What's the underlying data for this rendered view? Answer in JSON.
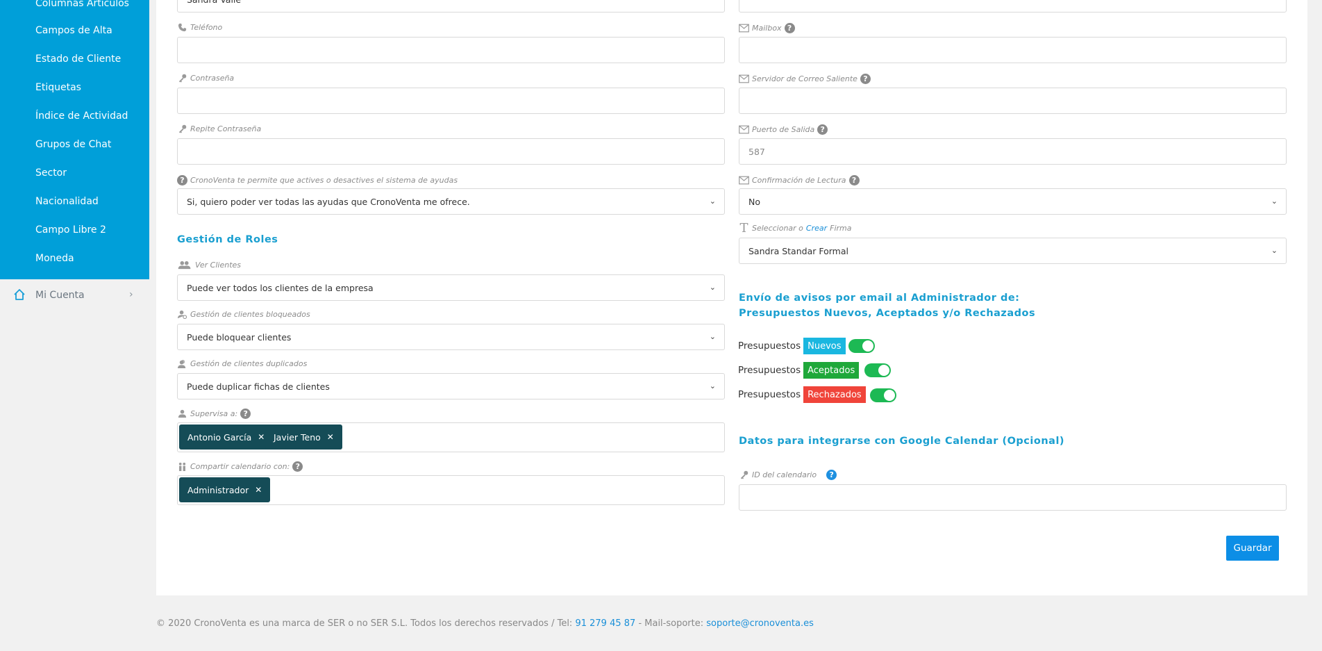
{
  "sidebar": {
    "items": [
      {
        "label": "Columnas Articulos"
      },
      {
        "label": "Campos de Alta"
      },
      {
        "label": "Estado de Cliente"
      },
      {
        "label": "Etiquetas"
      },
      {
        "label": "Índice de Actividad"
      },
      {
        "label": "Grupos de Chat"
      },
      {
        "label": "Sector"
      },
      {
        "label": "Nacionalidad"
      },
      {
        "label": "Campo Libre 2"
      },
      {
        "label": "Moneda"
      }
    ],
    "account": {
      "label": "Mi Cuenta",
      "chevron": "›"
    }
  },
  "left": {
    "name_value": "Sandra Valle",
    "phone": {
      "label": "Teléfono",
      "value": ""
    },
    "password": {
      "label": "Contraseña",
      "value": ""
    },
    "password_repeat": {
      "label": "Repite Contraseña",
      "value": ""
    },
    "help_system": {
      "label": "CronoVenta te permite que actives o desactives el sistema de ayudas",
      "value": "Si, quiero poder ver todas las ayudas que CronoVenta me ofrece."
    },
    "roles_title": "Gestión de Roles",
    "view_clients": {
      "label": "Ver Clientes",
      "value": "Puede ver todos los clientes de la empresa"
    },
    "blocked_clients": {
      "label": "Gestión de clientes bloqueados",
      "value": "Puede bloquear clientes"
    },
    "duplicate_clients": {
      "label": "Gestión de clientes duplicados",
      "value": "Puede duplicar fichas de clientes"
    },
    "supervises": {
      "label": "Supervisa a:",
      "tags": [
        "Antonio García",
        "Javier Teno"
      ]
    },
    "share_calendar": {
      "label": "Compartir calendario con:",
      "tags": [
        "Administrador"
      ]
    }
  },
  "right": {
    "mailbox": {
      "label": "Mailbox",
      "value": ""
    },
    "smtp_server": {
      "label": "Servidor de Correo Saliente",
      "value": ""
    },
    "out_port": {
      "label": "Puerto de Salida",
      "value": "587"
    },
    "read_receipt": {
      "label": "Confirmación de Lectura",
      "value": "No"
    },
    "signature": {
      "label_pre": "Seleccionar o",
      "label_link": "Crear",
      "label_post": "Firma",
      "value": "Sandra Standar Formal"
    },
    "notify_title_1": "Envío de avisos por email al Administrador de:",
    "notify_title_2": "Presupuestos Nuevos, Aceptados y/o Rechazados",
    "toggles": [
      {
        "prefix": "Presupuestos",
        "badge": "Nuevos",
        "badge_color": "#1ab7e0",
        "on": true
      },
      {
        "prefix": "Presupuestos",
        "badge": "Aceptados",
        "badge_color": "#1fa83a",
        "on": true
      },
      {
        "prefix": "Presupuestos",
        "badge": "Rechazados",
        "badge_color": "#f0443a",
        "on": true
      }
    ],
    "gcal_title": "Datos para integrarse con Google Calendar (Opcional)",
    "calendar_id": {
      "label": "ID del calendario",
      "value": ""
    }
  },
  "save_label": "Guardar",
  "footer": {
    "text": "© 2020 CronoVenta es una marca de SER o no SER S.L. Todos los derechos reservados / Tel:",
    "phone": "91 279 45 87",
    "mail_label": "- Mail-soporte:",
    "email": "soporte@cronoventa.es"
  },
  "colors": {
    "accent": "#009fd9",
    "tag": "#154c57",
    "switch_on": "#1db954",
    "button": "#0c8ee6"
  }
}
